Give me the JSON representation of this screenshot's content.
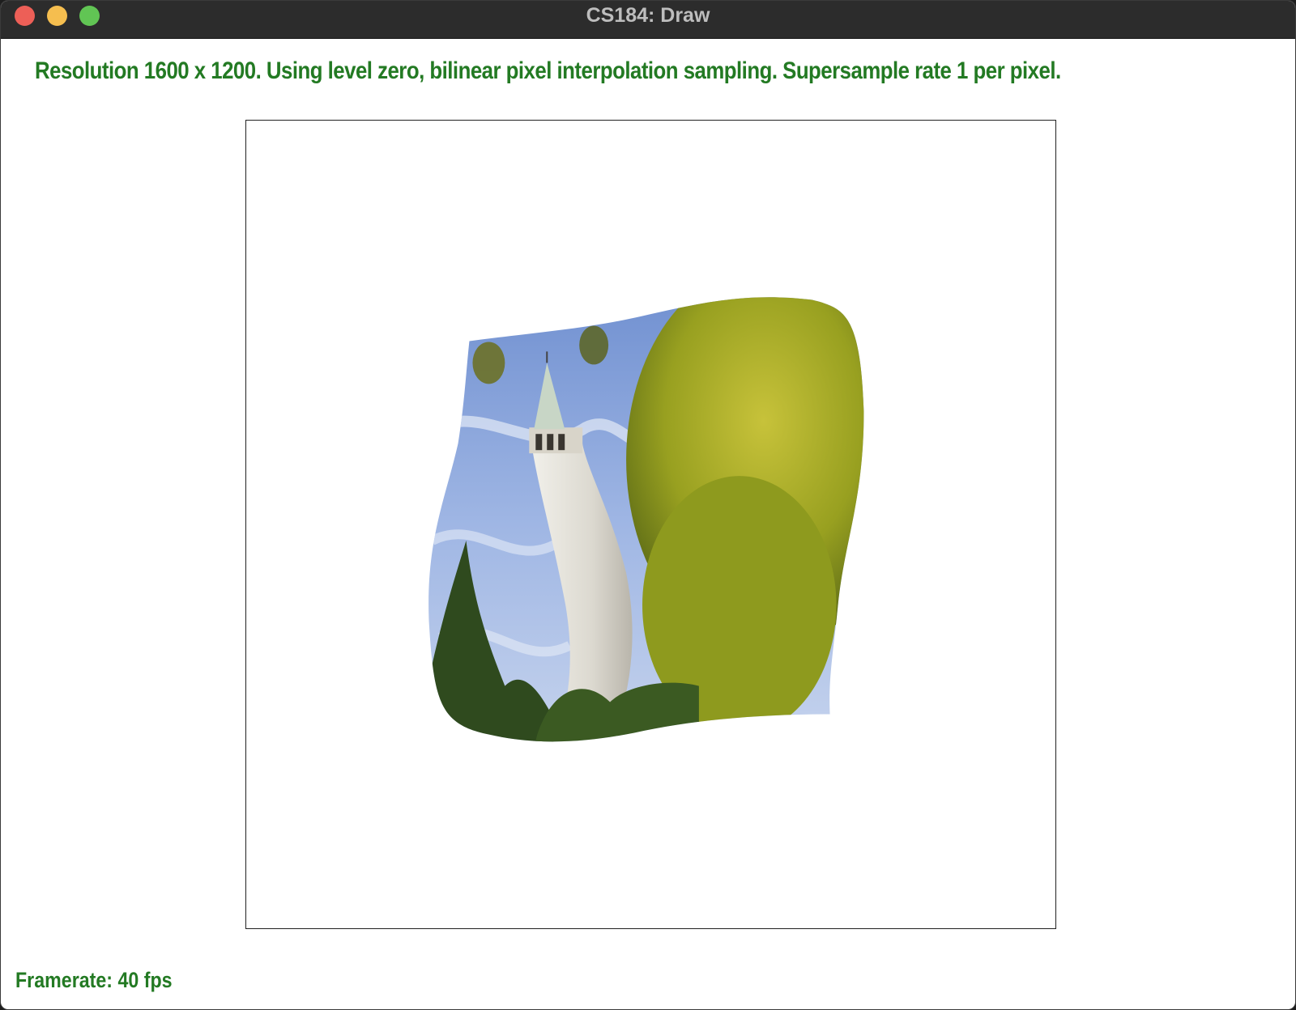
{
  "window": {
    "title": "CS184: Draw"
  },
  "status": {
    "text": "Resolution 1600 x 1200. Using level zero, bilinear pixel interpolation sampling. Supersample rate 1 per pixel."
  },
  "footer": {
    "framerate_text": "Framerate: 40 fps"
  },
  "colors": {
    "status_text": "#237a23",
    "titlebar": "#2c2c2c",
    "close": "#ed5f57",
    "minimize": "#f5be4f",
    "maximize": "#61c554"
  },
  "canvas": {
    "content": "warped texture-mapped photo of a clock tower among trees"
  }
}
